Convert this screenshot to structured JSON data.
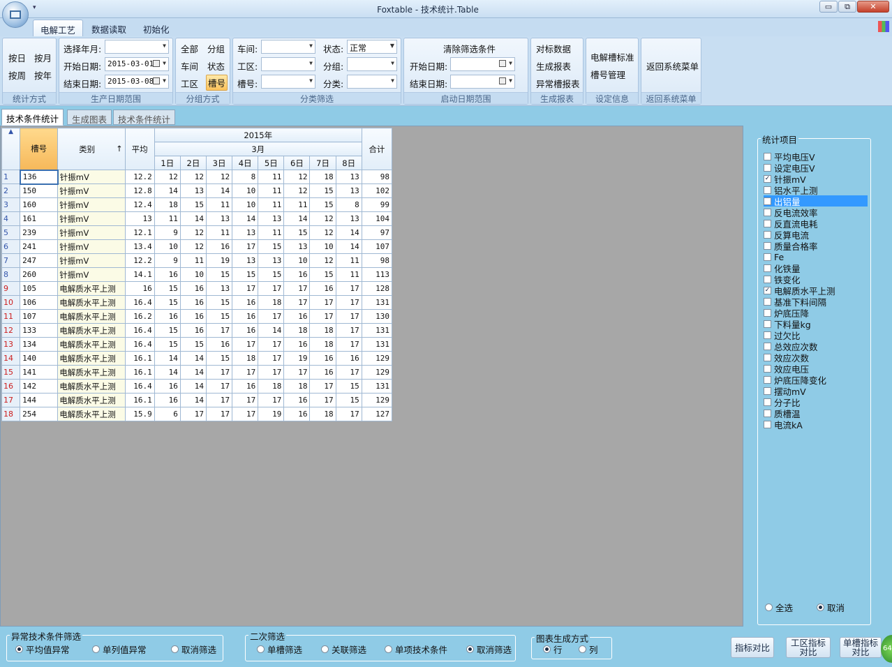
{
  "window": {
    "title": "Foxtable - 技术统计.Table",
    "min": "▭",
    "restore": "⧉",
    "close": "✕",
    "qa": "▾"
  },
  "ribbon_tabs": [
    "电解工艺",
    "数据读取",
    "初始化"
  ],
  "groups": {
    "stat": {
      "label": "统计方式",
      "buttons": [
        "按日",
        "按月",
        "按周",
        "按年"
      ]
    },
    "date": {
      "label": "生产日期范围",
      "month_label": "选择年月:",
      "start_label": "开始日期:",
      "start_value": "2015-03-01",
      "end_label": "结束日期:",
      "end_value": "2015-03-08"
    },
    "group": {
      "label": "分组方式",
      "buttons": [
        "全部",
        "分组",
        "车间",
        "状态",
        "工区",
        "槽号"
      ]
    },
    "filter": {
      "label": "分类筛选",
      "fields": [
        "车间:",
        "工区:",
        "槽号:",
        "状态:",
        "分组:",
        "分类:"
      ],
      "status_value": "正常"
    },
    "startdate": {
      "label": "启动日期范围",
      "clear": "清除筛选条件",
      "start_label": "开始日期:",
      "end_label": "结束日期:"
    },
    "report": {
      "label": "生成报表",
      "buttons": [
        "对标数据",
        "生成报表",
        "异常槽报表"
      ]
    },
    "setting": {
      "label": "设定信息",
      "buttons": [
        "电解槽标准",
        "槽号管理"
      ]
    },
    "back": {
      "label": "返回系统菜单",
      "button": "返回系统菜单"
    }
  },
  "doc_tabs": [
    "技术条件统计",
    "生成图表",
    "技术条件统计"
  ],
  "grid": {
    "corner": "▲",
    "headers": {
      "slot": "槽号",
      "category": "类别",
      "sort": "↑",
      "avg": "平均",
      "year": "2015年",
      "month": "3月",
      "total": "合计",
      "days": [
        "1日",
        "2日",
        "3日",
        "4日",
        "5日",
        "6日",
        "7日",
        "8日"
      ]
    },
    "rows": [
      {
        "n": "1",
        "id": "136",
        "cat": "针振mV",
        "avg": "12.2",
        "d": [
          "12",
          "12",
          "12",
          "8",
          "11",
          "12",
          "18",
          "13"
        ],
        "tot": "98"
      },
      {
        "n": "2",
        "id": "150",
        "cat": "针振mV",
        "avg": "12.8",
        "d": [
          "14",
          "13",
          "14",
          "10",
          "11",
          "12",
          "15",
          "13"
        ],
        "tot": "102"
      },
      {
        "n": "3",
        "id": "160",
        "cat": "针振mV",
        "avg": "12.4",
        "d": [
          "18",
          "15",
          "11",
          "10",
          "11",
          "11",
          "15",
          "8"
        ],
        "tot": "99"
      },
      {
        "n": "4",
        "id": "161",
        "cat": "针振mV",
        "avg": "13",
        "d": [
          "11",
          "14",
          "13",
          "14",
          "13",
          "14",
          "12",
          "13"
        ],
        "tot": "104"
      },
      {
        "n": "5",
        "id": "239",
        "cat": "针振mV",
        "avg": "12.1",
        "d": [
          "9",
          "12",
          "11",
          "13",
          "11",
          "15",
          "12",
          "14"
        ],
        "tot": "97"
      },
      {
        "n": "6",
        "id": "241",
        "cat": "针振mV",
        "avg": "13.4",
        "d": [
          "10",
          "12",
          "16",
          "17",
          "15",
          "13",
          "10",
          "14"
        ],
        "tot": "107"
      },
      {
        "n": "7",
        "id": "247",
        "cat": "针振mV",
        "avg": "12.2",
        "d": [
          "9",
          "11",
          "19",
          "13",
          "13",
          "10",
          "12",
          "11"
        ],
        "tot": "98"
      },
      {
        "n": "8",
        "id": "260",
        "cat": "针振mV",
        "avg": "14.1",
        "d": [
          "16",
          "10",
          "15",
          "15",
          "15",
          "16",
          "15",
          "11"
        ],
        "tot": "113"
      },
      {
        "n": "9",
        "id": "105",
        "cat": "电解质水平上测",
        "avg": "16",
        "d": [
          "15",
          "16",
          "13",
          "17",
          "17",
          "17",
          "16",
          "17"
        ],
        "tot": "128"
      },
      {
        "n": "10",
        "id": "106",
        "cat": "电解质水平上测",
        "avg": "16.4",
        "d": [
          "15",
          "16",
          "15",
          "16",
          "18",
          "17",
          "17",
          "17"
        ],
        "tot": "131"
      },
      {
        "n": "11",
        "id": "107",
        "cat": "电解质水平上测",
        "avg": "16.2",
        "d": [
          "16",
          "16",
          "15",
          "16",
          "17",
          "16",
          "17",
          "17"
        ],
        "tot": "130"
      },
      {
        "n": "12",
        "id": "133",
        "cat": "电解质水平上测",
        "avg": "16.4",
        "d": [
          "15",
          "16",
          "17",
          "16",
          "14",
          "18",
          "18",
          "17"
        ],
        "tot": "131"
      },
      {
        "n": "13",
        "id": "134",
        "cat": "电解质水平上测",
        "avg": "16.4",
        "d": [
          "15",
          "15",
          "16",
          "17",
          "17",
          "16",
          "18",
          "17"
        ],
        "tot": "131"
      },
      {
        "n": "14",
        "id": "140",
        "cat": "电解质水平上测",
        "avg": "16.1",
        "d": [
          "14",
          "14",
          "15",
          "18",
          "17",
          "19",
          "16",
          "16"
        ],
        "tot": "129"
      },
      {
        "n": "15",
        "id": "141",
        "cat": "电解质水平上测",
        "avg": "16.1",
        "d": [
          "14",
          "14",
          "17",
          "17",
          "17",
          "17",
          "16",
          "17"
        ],
        "tot": "129"
      },
      {
        "n": "16",
        "id": "142",
        "cat": "电解质水平上测",
        "avg": "16.4",
        "d": [
          "16",
          "14",
          "17",
          "16",
          "18",
          "18",
          "17",
          "15"
        ],
        "tot": "131"
      },
      {
        "n": "17",
        "id": "144",
        "cat": "电解质水平上测",
        "avg": "16.1",
        "d": [
          "16",
          "14",
          "17",
          "17",
          "17",
          "16",
          "17",
          "15"
        ],
        "tot": "129"
      },
      {
        "n": "18",
        "id": "254",
        "cat": "电解质水平上测",
        "avg": "15.9",
        "d": [
          "6",
          "17",
          "17",
          "17",
          "19",
          "16",
          "18",
          "17"
        ],
        "tot": "127"
      }
    ]
  },
  "stat_items": {
    "legend": "统计项目",
    "items": [
      {
        "label": "平均电压V",
        "checked": false
      },
      {
        "label": "设定电压V",
        "checked": false
      },
      {
        "label": "针振mV",
        "checked": true
      },
      {
        "label": "铝水平上测",
        "checked": false
      },
      {
        "label": "出铝量",
        "checked": false,
        "highlight": true
      },
      {
        "label": "反电流效率",
        "checked": false
      },
      {
        "label": "反直流电耗",
        "checked": false
      },
      {
        "label": "反算电流",
        "checked": false
      },
      {
        "label": "质量合格率",
        "checked": false
      },
      {
        "label": "Fe",
        "checked": false
      },
      {
        "label": "化铁量",
        "checked": false
      },
      {
        "label": "铁变化",
        "checked": false
      },
      {
        "label": "电解质水平上测",
        "checked": true
      },
      {
        "label": "基准下料间隔",
        "checked": false
      },
      {
        "label": "炉底压降",
        "checked": false
      },
      {
        "label": "下料量kg",
        "checked": false
      },
      {
        "label": "过欠比",
        "checked": false
      },
      {
        "label": "总效应次数",
        "checked": false
      },
      {
        "label": "效应次数",
        "checked": false
      },
      {
        "label": "效应电压",
        "checked": false
      },
      {
        "label": "炉底压降变化",
        "checked": false
      },
      {
        "label": "摆动mV",
        "checked": false
      },
      {
        "label": "分子比",
        "checked": false
      },
      {
        "label": "质槽温",
        "checked": false
      },
      {
        "label": "电流kA",
        "checked": false
      }
    ],
    "select_all": "全选",
    "cancel": "取消"
  },
  "bottom": {
    "abnormal": {
      "legend": "异常技术条件筛选",
      "options": [
        "平均值异常",
        "单列值异常",
        "取消筛选"
      ]
    },
    "secondary": {
      "legend": "二次筛选",
      "options": [
        "单槽筛选",
        "关联筛选",
        "单项技术条件",
        "取消筛选"
      ]
    },
    "chartmode": {
      "legend": "图表生成方式",
      "options": [
        "行",
        "列"
      ]
    },
    "buttons": [
      "指标对比",
      "工区指标\n对比",
      "单槽指标\n对比"
    ],
    "badge": "64"
  }
}
